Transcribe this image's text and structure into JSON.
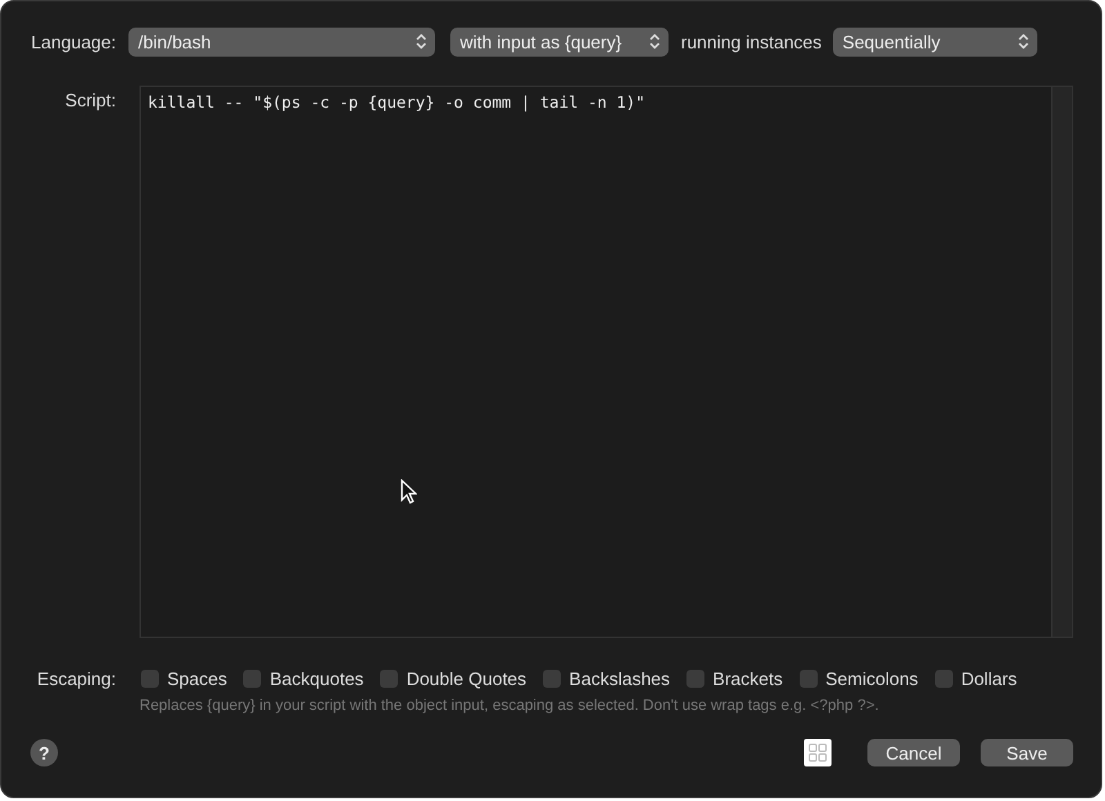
{
  "language": {
    "label": "Language:",
    "value": "/bin/bash"
  },
  "input_mode": {
    "value": "with input as {query}"
  },
  "instances": {
    "label": "running instances",
    "value": "Sequentially"
  },
  "script": {
    "label": "Script:",
    "value": "killall -- \"$(ps -c -p {query} -o comm | tail -n 1)\""
  },
  "escaping": {
    "label": "Escaping:",
    "options": [
      {
        "label": "Spaces",
        "checked": false
      },
      {
        "label": "Backquotes",
        "checked": false
      },
      {
        "label": "Double Quotes",
        "checked": false
      },
      {
        "label": "Backslashes",
        "checked": false
      },
      {
        "label": "Brackets",
        "checked": false
      },
      {
        "label": "Semicolons",
        "checked": false
      },
      {
        "label": "Dollars",
        "checked": false
      }
    ]
  },
  "hint": "Replaces {query} in your script with the object input, escaping as selected. Don't use wrap tags e.g. <?php ?>.",
  "help": "?",
  "buttons": [
    "Cancel",
    "Save"
  ]
}
